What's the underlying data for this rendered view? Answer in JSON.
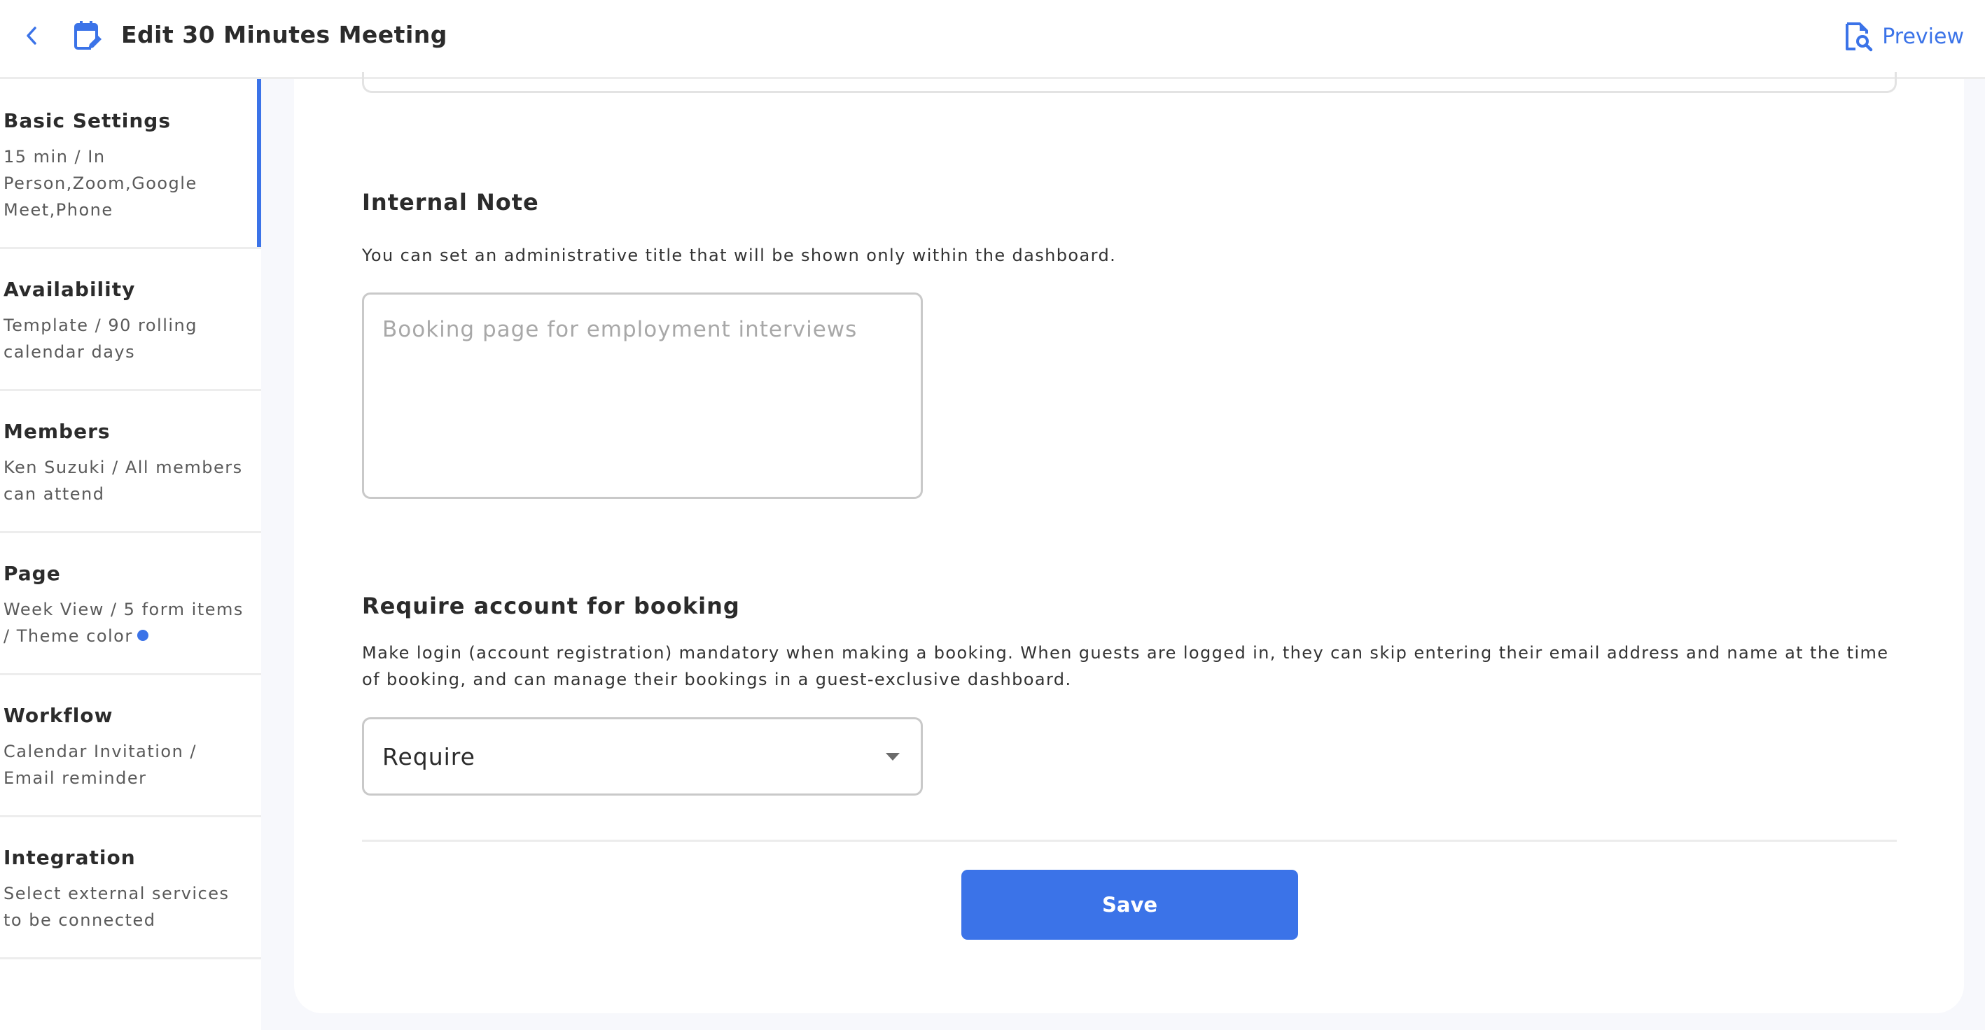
{
  "header": {
    "title": "Edit 30 Minutes Meeting",
    "back_icon": "chevron-left-icon",
    "title_icon": "calendar-edit-icon",
    "preview_label": "Preview",
    "preview_icon": "document-search-icon"
  },
  "sidebar": {
    "items": [
      {
        "title": "Basic Settings",
        "desc": "15 min / In Person,Zoom,Google Meet,Phone",
        "active": true
      },
      {
        "title": "Availability",
        "desc": "Template / 90 rolling calendar days",
        "active": false
      },
      {
        "title": "Members",
        "desc": "Ken Suzuki / All members can attend",
        "active": false
      },
      {
        "title": "Page",
        "desc": "Week View / 5 form items / Theme color",
        "active": false,
        "theme_color": "#3b73e8"
      },
      {
        "title": "Workflow",
        "desc": "Calendar Invitation / Email reminder",
        "active": false
      },
      {
        "title": "Integration",
        "desc": "Select external services to be connected",
        "active": false
      }
    ]
  },
  "main": {
    "internal_note": {
      "title": "Internal Note",
      "description": "You can set an administrative title that will be shown only within the dashboard.",
      "value": "",
      "placeholder": "Booking page for employment interviews"
    },
    "require_account": {
      "title": "Require account for booking",
      "description": "Make login (account registration) mandatory when making a booking. When guests are logged in, they can skip entering their email address and name at the time of booking, and can manage their bookings in a guest-exclusive dashboard.",
      "selected": "Require"
    },
    "save_label": "Save"
  },
  "colors": {
    "accent": "#3b73e8",
    "background": "#f7f8fc",
    "text": "#2b2b2b"
  }
}
